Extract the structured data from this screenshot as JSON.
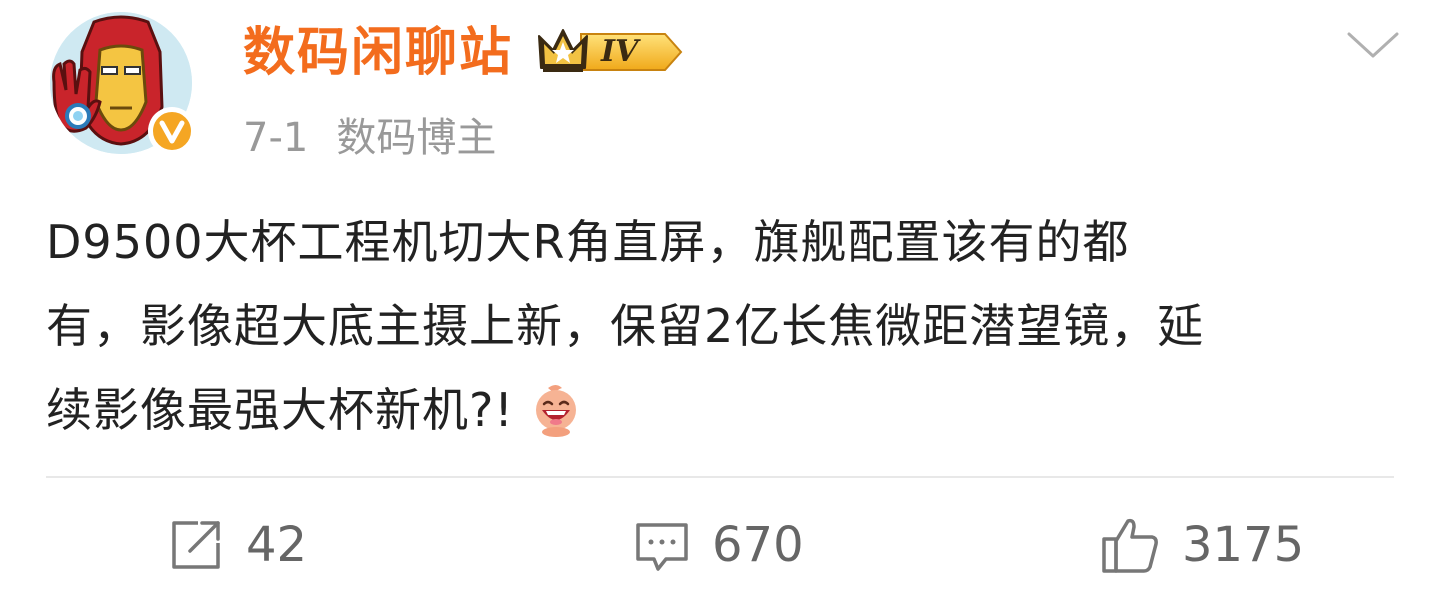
{
  "post": {
    "author": {
      "name": "数码闲聊站",
      "level_badge": "IV",
      "verified_mark": "V"
    },
    "meta": {
      "date": "7-1",
      "category": "数码博主"
    },
    "content": {
      "line1": "D9500大杯工程机切大R角直屏，旗舰配置该有的都",
      "line2": "有，影像超大底主摄上新，保留2亿长焦微距潜望镜，延",
      "line3": "续影像最强大杯新机?!",
      "emoji": "laughing-face-emoji"
    },
    "actions": {
      "repost_count": "42",
      "comment_count": "670",
      "like_count": "3175"
    },
    "icons": {
      "repost": "share-icon",
      "comment": "comment-icon",
      "like": "thumbs-up-icon",
      "expand": "chevron-down-icon"
    },
    "colors": {
      "username": "#f36c1d",
      "meta": "#999999",
      "text": "#222222",
      "action": "#666666",
      "verified_badge": "#f5a623",
      "level_badge": "#f7b928"
    }
  }
}
